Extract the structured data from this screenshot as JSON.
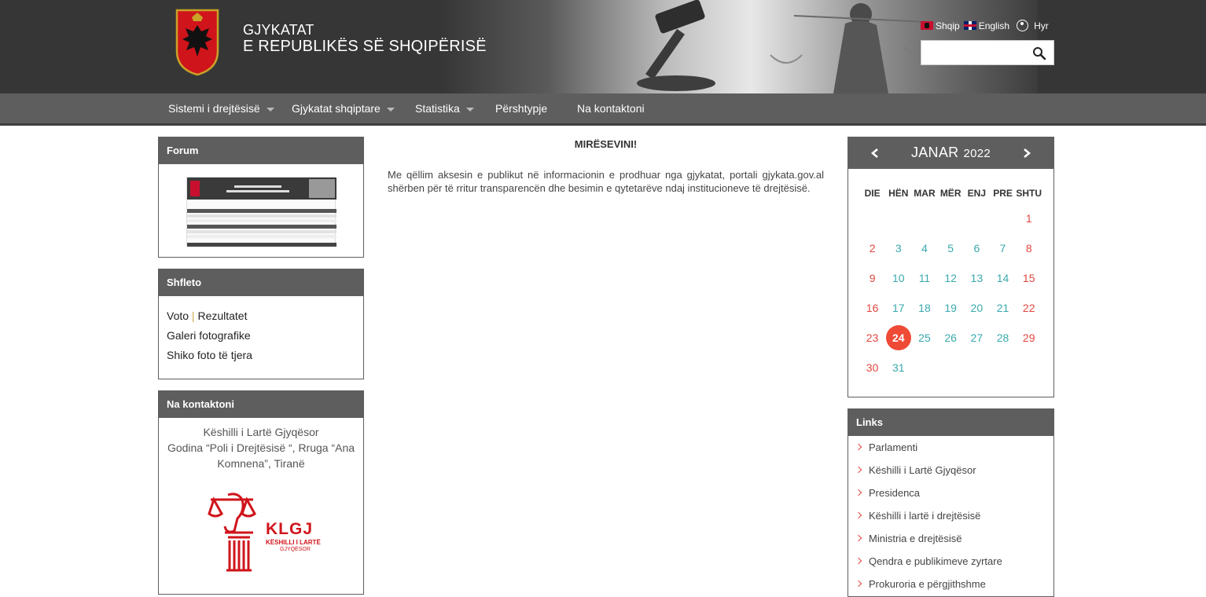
{
  "header": {
    "title_line1": "GJYKATAT",
    "title_line2": "E REPUBLIKËS SË SHQIPËRISË",
    "lang_sq": "Shqip",
    "lang_en": "English",
    "login": "Hyr",
    "search_value": ""
  },
  "nav": {
    "items": [
      {
        "label": "Sistemi i drejtësisë"
      },
      {
        "label": "Gjykatat shqiptare"
      },
      {
        "label": "Statistika"
      },
      {
        "label": "Përshtypje"
      },
      {
        "label": "Na kontaktoni"
      }
    ]
  },
  "forum": {
    "title": "Forum"
  },
  "shfleto": {
    "title": "Shfleto",
    "voto": "Voto",
    "separator": "|",
    "rezultatet": "Rezultatet",
    "galeri": "Galeri fotografike",
    "shiko": "Shiko foto të tjera"
  },
  "contact": {
    "title": "Na kontaktoni",
    "line1": "Këshilli i Lartë Gjyqësor",
    "line2": "Godina “Poli i Drejtësisë “, Rruga “Ana Komnena”, Tiranë",
    "logo_abbr": "KLGJ",
    "logo_sub1": "KËSHILLI I LARTË",
    "logo_sub2": "GJYQËSOR"
  },
  "main": {
    "welcome": "MIRËSEVINI!",
    "intro": "Me qëllim aksesin e publikut në informacionin e prodhuar nga gjykatat, portali gjykata.gov.al shërben për të rritur transparencën dhe besimin e qytetarëve ndaj institucioneve të drejtësisë."
  },
  "calendar": {
    "month": "JANAR",
    "year": "2022",
    "weekdays": [
      "DIE",
      "HËN",
      "MAR",
      "MËR",
      "ENJ",
      "PRE",
      "SHTU"
    ],
    "today": 24,
    "weeks": [
      [
        "",
        "",
        "",
        "",
        "",
        "",
        "1"
      ],
      [
        "2",
        "3",
        "4",
        "5",
        "6",
        "7",
        "8"
      ],
      [
        "9",
        "10",
        "11",
        "12",
        "13",
        "14",
        "15"
      ],
      [
        "16",
        "17",
        "18",
        "19",
        "20",
        "21",
        "22"
      ],
      [
        "23",
        "24",
        "25",
        "26",
        "27",
        "28",
        "29"
      ],
      [
        "30",
        "31",
        "",
        "",
        "",
        "",
        ""
      ]
    ],
    "colors": {
      "weekend": "#e0473f",
      "weekday": "#3aa9ad",
      "today_bg": "#ef4a36"
    }
  },
  "links": {
    "title": "Links",
    "items": [
      "Parlamenti",
      "Këshilli i Lartë Gjyqësor",
      "Presidenca",
      "Këshilli i lartë i drejtësisë",
      "Ministria e drejtësisë",
      "Qendra e publikimeve zyrtare",
      "Prokuroria e përgjithshme"
    ]
  },
  "colors": {
    "header_bg": "#363636",
    "nav_bg": "#5e5e5e",
    "accent_red": "#e0473f",
    "accent_teal": "#3aa9ad"
  }
}
